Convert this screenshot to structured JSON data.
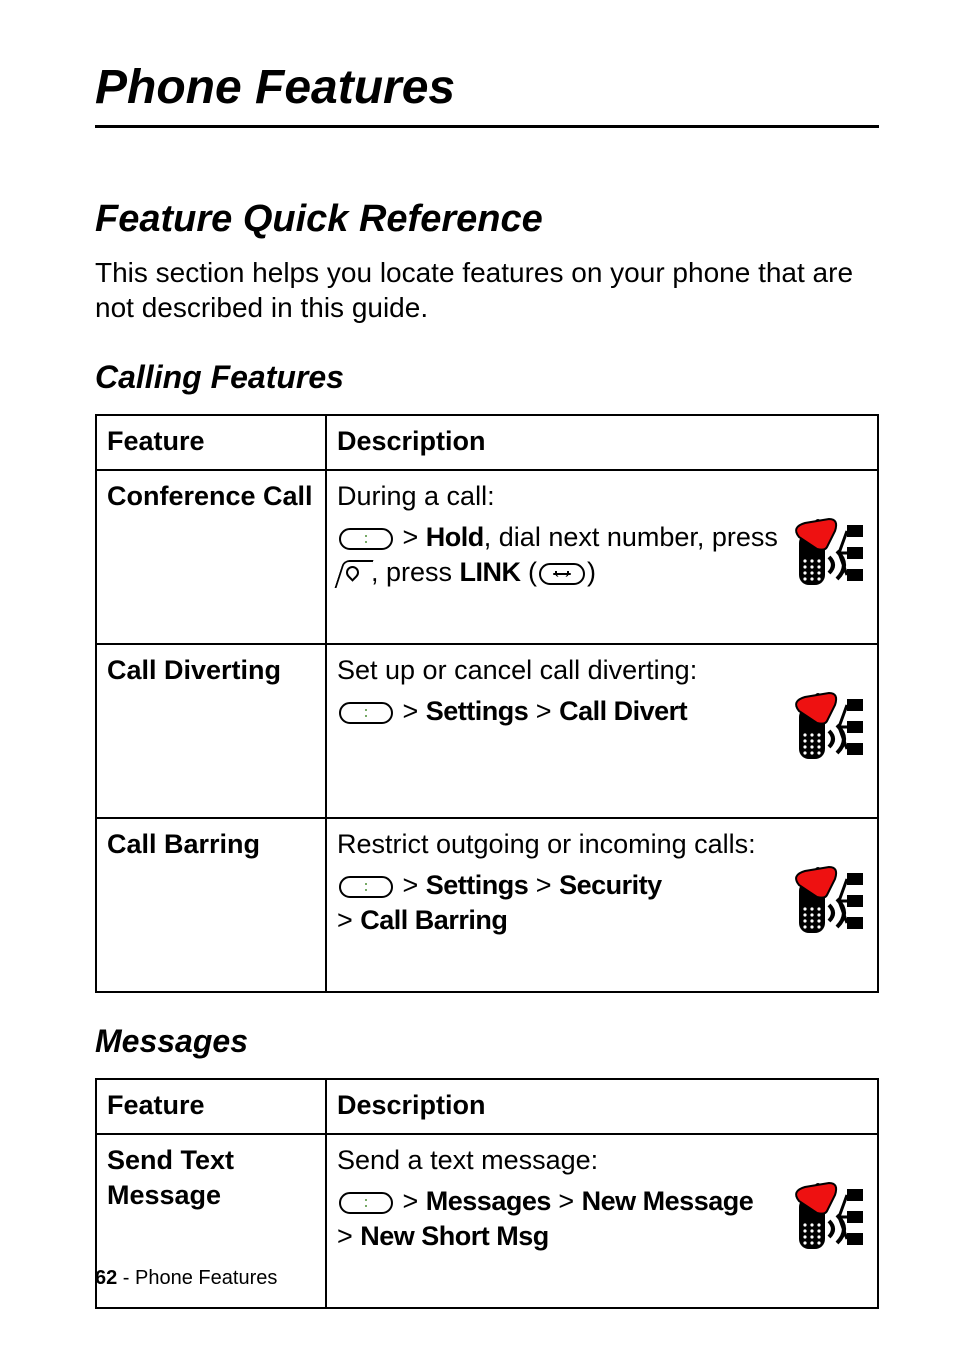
{
  "chapter": {
    "title": "Phone Features"
  },
  "section": {
    "title": "Feature Quick Reference",
    "intro": "This section helps you locate features on your phone that are not described in this guide."
  },
  "calling": {
    "title": "Calling Features",
    "header_feature": "Feature",
    "header_desc": "Description",
    "rows": [
      {
        "feature": "Conference Call",
        "lead": "During a call:",
        "nav_pre": " > ",
        "nav_b1": "Hold",
        "nav_mid1": ", dial next number, press ",
        "nav_mid2": ", press ",
        "nav_b2": "LINK",
        "nav_mid3": " (",
        "nav_end": ")"
      },
      {
        "feature": "Call Diverting",
        "lead": "Set up or cancel call diverting:",
        "nav_pre": " > ",
        "nav_b1": "Settings",
        "nav_sep1": " > ",
        "nav_b2": "Call Divert"
      },
      {
        "feature": "Call Barring",
        "lead": "Restrict outgoing or incoming calls:",
        "nav_pre": " > ",
        "nav_b1": "Settings",
        "nav_sep1": " > ",
        "nav_b2": "Security",
        "nav_line2_pre": "> ",
        "nav_b3": "Call Barring"
      }
    ]
  },
  "messages": {
    "title": "Messages",
    "header_feature": "Feature",
    "header_desc": "Description",
    "rows": [
      {
        "feature": "Send Text Message",
        "lead": "Send a text message:",
        "nav_pre": " > ",
        "nav_b1": "Messages",
        "nav_sep1": " > ",
        "nav_b2": "New Message",
        "nav_line2_pre": "> ",
        "nav_b3": "New Short Msg"
      }
    ]
  },
  "footer": {
    "page": "62",
    "sep": " - ",
    "label": "Phone Features"
  }
}
